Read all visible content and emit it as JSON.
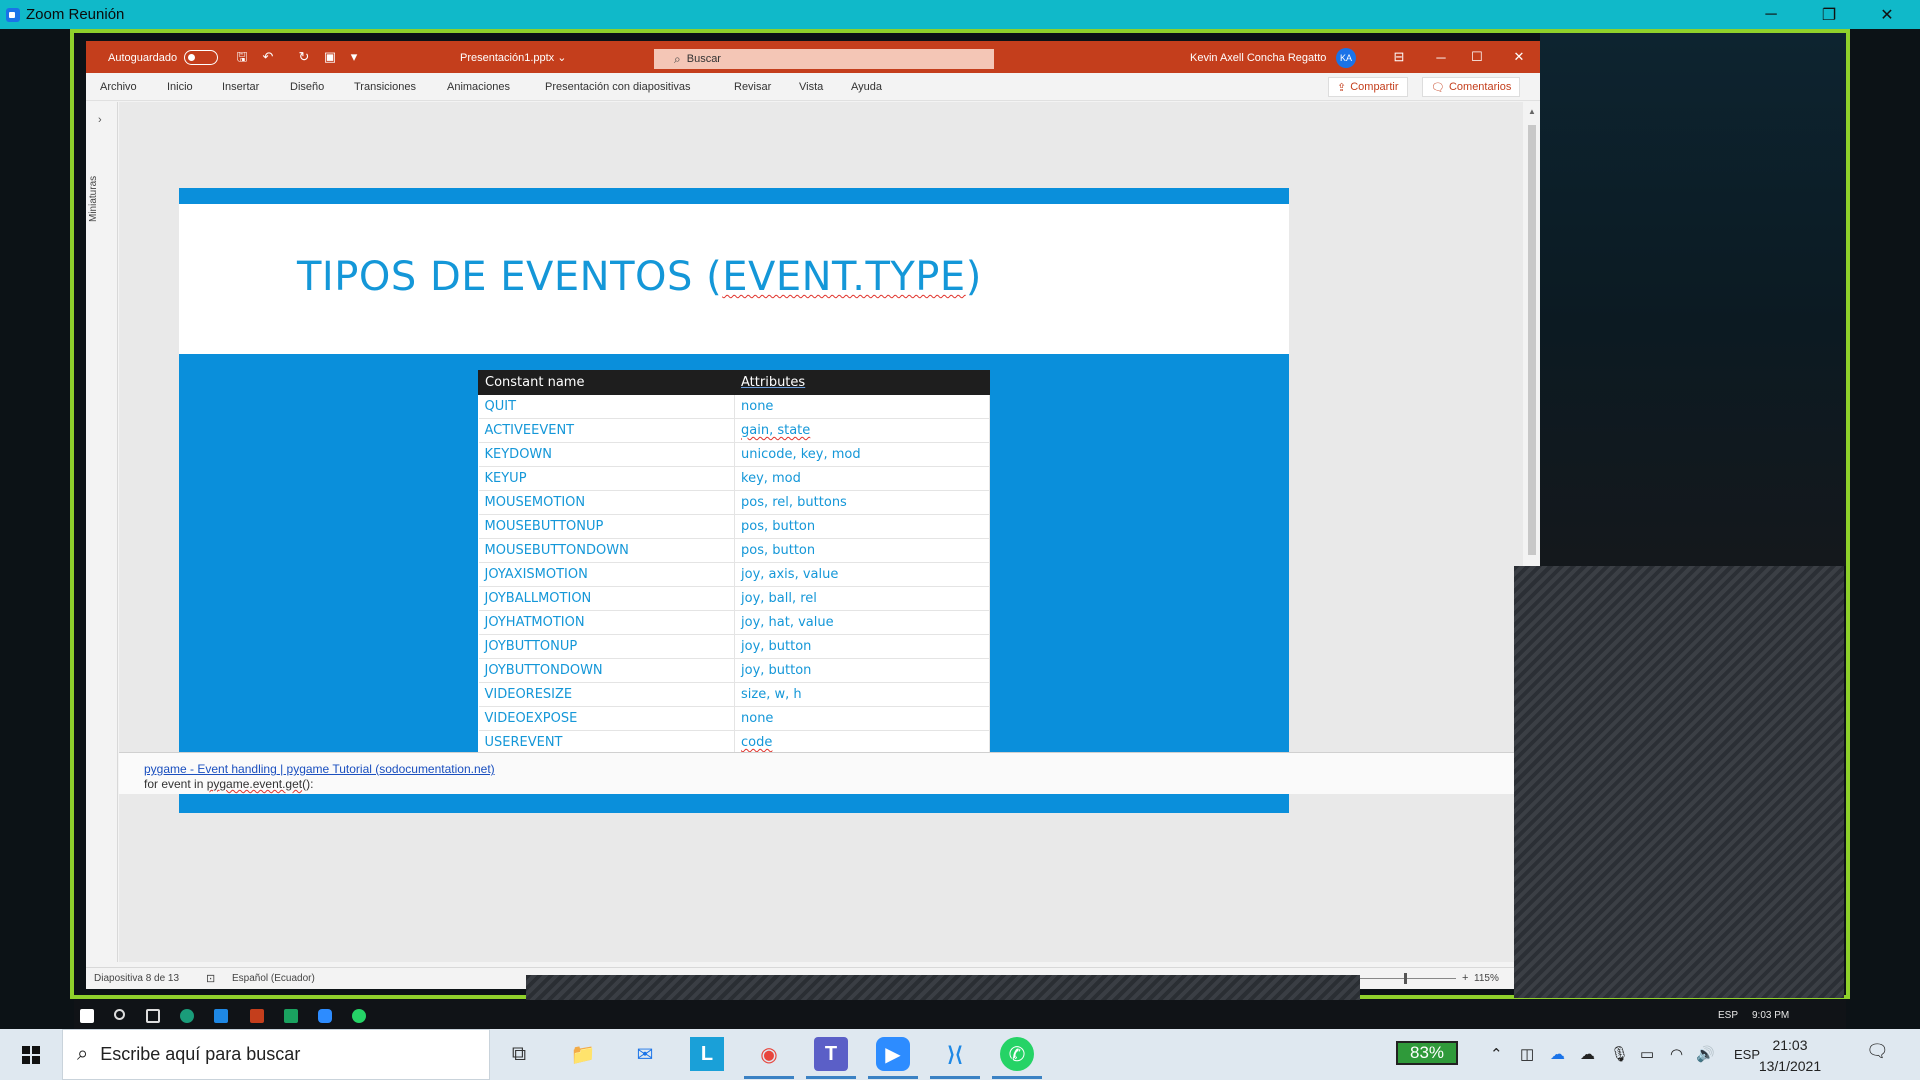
{
  "zoom": {
    "title": "Zoom Reunión",
    "window_controls": {
      "minimize": "─",
      "restore": "❐",
      "close": "✕"
    }
  },
  "powerpoint": {
    "autosave_label": "Autoguardado",
    "document_name": "Presentación1.pptx",
    "doc_dropdown": "⌄",
    "search_placeholder": "Buscar",
    "user_name": "Kevin Axell Concha Regatto",
    "user_initials": "KA",
    "qat_icons": {
      "save": "🖫",
      "undo": "↶",
      "redo": "↻",
      "present": "▣",
      "more": "▾"
    },
    "window_controls": {
      "ribbon_display": "⊟",
      "minimize": "─",
      "maximize": "☐",
      "close": "✕"
    },
    "ribbon_tabs": [
      "Archivo",
      "Inicio",
      "Insertar",
      "Diseño",
      "Transiciones",
      "Animaciones",
      "Presentación con diapositivas",
      "Revisar",
      "Vista",
      "Ayuda"
    ],
    "share_button": "Compartir",
    "comments_button": "Comentarios",
    "thumbnails_label": "Miniaturas",
    "thumbnails_chevron": "›",
    "scroll_up": "▲",
    "slide": {
      "title_prefix": "TIPOS DE EVENTOS (",
      "title_code": "EVENT.TYPE",
      "title_suffix": ")",
      "table": {
        "headers": [
          "Constant name",
          "Attributes"
        ],
        "rows": [
          [
            "QUIT",
            "none"
          ],
          [
            "ACTIVEEVENT",
            "gain, state"
          ],
          [
            "KEYDOWN",
            "unicode, key, mod"
          ],
          [
            "KEYUP",
            "key, mod"
          ],
          [
            "MOUSEMOTION",
            "pos, rel, buttons"
          ],
          [
            "MOUSEBUTTONUP",
            "pos, button"
          ],
          [
            "MOUSEBUTTONDOWN",
            "pos, button"
          ],
          [
            "JOYAXISMOTION",
            "joy, axis, value"
          ],
          [
            "JOYBALLMOTION",
            "joy, ball, rel"
          ],
          [
            "JOYHATMOTION",
            "joy, hat, value"
          ],
          [
            "JOYBUTTONUP",
            "joy, button"
          ],
          [
            "JOYBUTTONDOWN",
            "joy, button"
          ],
          [
            "VIDEORESIZE",
            "size, w, h"
          ],
          [
            "VIDEOEXPOSE",
            "none"
          ],
          [
            "USEREVENT",
            "code"
          ]
        ]
      }
    },
    "notes": {
      "link": "pygame - Event handling | pygame Tutorial (sodocumentation.net)",
      "code_prefix": "for event in ",
      "code_squiggle": "pygame.event.get",
      "code_suffix": "():"
    },
    "status": {
      "slide_counter": "Diapositiva 8 de 13",
      "language": "Español (Ecuador)",
      "zoom_plus": "+",
      "zoom": "115%"
    }
  },
  "inner_taskbar": {
    "lang": "ESP",
    "time": "9:03 PM",
    "icons": [
      "windows-start",
      "search",
      "task-view",
      "edge",
      "vscode",
      "powerpoint",
      "app-green",
      "zoom",
      "whatsapp"
    ]
  },
  "taskbar": {
    "search_placeholder": "Escribe aquí para buscar",
    "apps": [
      "task-view",
      "file-explorer",
      "mail",
      "L-app",
      "chrome",
      "teams",
      "zoom",
      "vscode",
      "whatsapp"
    ],
    "app_labels": {
      "task_view": "⧉",
      "explorer": "📁",
      "mail": "✉",
      "l_app": "L",
      "chrome": "◉",
      "teams": "T",
      "zoom": "▶",
      "vscode": "⟩⟨",
      "whatsapp": "✆"
    },
    "battery": "83%",
    "tray_icons": {
      "chevron": "⌃",
      "meet": "◫",
      "onedrive": "☁",
      "cloud": "☁",
      "mic": "🎙",
      "battery": "▭",
      "wifi": "◠",
      "speaker": "🔊"
    },
    "language": "ESP",
    "time": "21:03",
    "date": "13/1/2021",
    "notifications": "🗨"
  },
  "colors": {
    "zoom_bar": "#10b9c9",
    "share_border": "#8fd12b",
    "ppt_red": "#c43e1c",
    "slide_blue": "#0a8fdb",
    "slide_text": "#1497d8"
  }
}
